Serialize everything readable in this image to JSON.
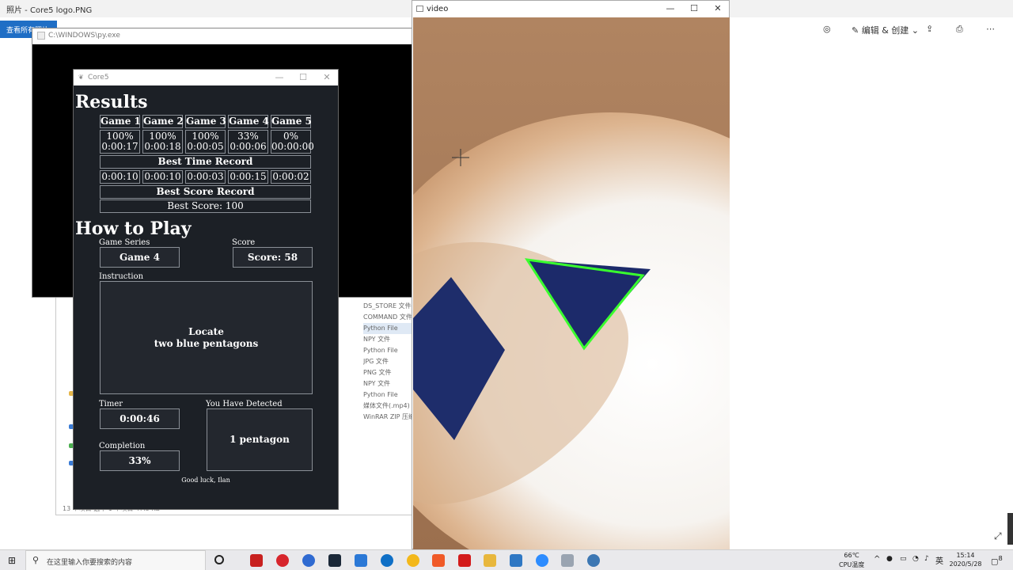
{
  "photos_app": {
    "title": "照片 - Core5 logo.PNG",
    "view_button": "查看所有照片",
    "toolbar_edit": "编辑 & 创建"
  },
  "explorer": {
    "file_types": [
      "DS_STORE 文件",
      "COMMAND 文件",
      "Python File",
      "NPY 文件",
      "Python File",
      "JPG 文件",
      "PNG 文件",
      "NPY 文件",
      "Python File",
      "媒体文件(.mp4)",
      "WinRAR ZIP 压缩"
    ],
    "status": "13 个项目    选中 1 个项目  47.5 KB"
  },
  "console": {
    "title": "C:\\WINDOWS\\py.exe"
  },
  "core5": {
    "window_title": "Core5",
    "results_heading": "Results",
    "games": [
      {
        "name": "Game 1",
        "score": "100%",
        "time": "0:00:17",
        "best_time": "0:00:10"
      },
      {
        "name": "Game 2",
        "score": "100%",
        "time": "0:00:18",
        "best_time": "0:00:10"
      },
      {
        "name": "Game 3",
        "score": "100%",
        "time": "0:00:05",
        "best_time": "0:00:03"
      },
      {
        "name": "Game 4",
        "score": "33%",
        "time": "0:00:06",
        "best_time": "0:00:15"
      },
      {
        "name": "Game 5",
        "score": "0%",
        "time": "00:00:00",
        "best_time": "0:00:02"
      }
    ],
    "best_time_record_label": "Best Time Record",
    "best_score_record_label": "Best Score Record",
    "best_score_value": "Best Score: 100",
    "how_to_play_heading": "How to Play",
    "game_series_label": "Game Series",
    "game_series_value": "Game 4",
    "score_label": "Score",
    "score_value": "Score: 58",
    "instruction_label": "Instruction",
    "instruction_line1": "Locate",
    "instruction_line2": "two blue pentagons",
    "timer_label": "Timer",
    "timer_value": "0:00:46",
    "detected_label": "You Have Detected",
    "detected_value": "1 pentagon",
    "completion_label": "Completion",
    "completion_value": "33%",
    "footer": "Good luck, Ilan"
  },
  "video": {
    "title": "video"
  },
  "taskbar": {
    "search_placeholder": "在这里输入你要搜索的内容",
    "temperature": "66℃",
    "cpu_label": "CPU温度",
    "ime": "英",
    "time": "15:14",
    "date": "2020/5/28",
    "notif_count": "8"
  }
}
